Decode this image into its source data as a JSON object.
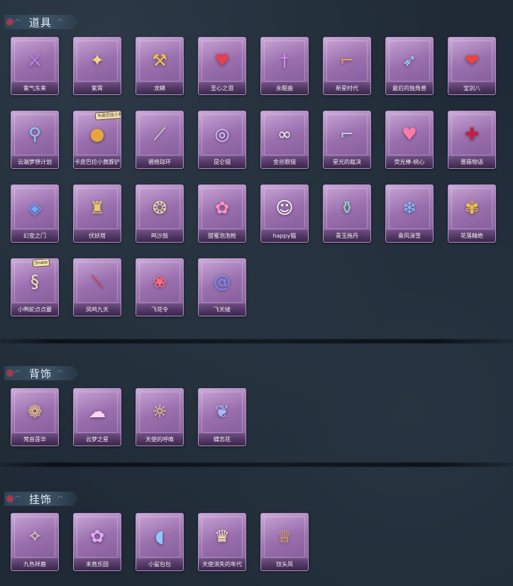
{
  "sections": {
    "props": {
      "title": "道具",
      "items": [
        {
          "name": "紫气东来",
          "icon": "purple-blade-icon",
          "glyph": "⚔",
          "color": "#c28bff"
        },
        {
          "name": "紫霄",
          "icon": "purple-chain-icon",
          "glyph": "✦",
          "color": "#f3d58a"
        },
        {
          "name": "龙鳞",
          "icon": "golden-shovel-icon",
          "glyph": "⚒",
          "color": "#e8c24a"
        },
        {
          "name": "圣心之泪",
          "icon": "red-heart-staff-icon",
          "glyph": "♥",
          "color": "#e5404f"
        },
        {
          "name": "永眠曲",
          "icon": "violet-sword-icon",
          "glyph": "†",
          "color": "#d78cff"
        },
        {
          "name": "新星时代",
          "icon": "revolver-icon",
          "glyph": "⌐",
          "color": "#e6a24a"
        },
        {
          "name": "最后的独角兽",
          "icon": "unicorn-horn-icon",
          "glyph": "➶",
          "color": "#8fd4ff"
        },
        {
          "name": "宝剑八",
          "icon": "heart-shield-icon",
          "glyph": "❤",
          "color": "#e9463d"
        },
        {
          "name": "云端梦想计划",
          "icon": "blue-hammer-icon",
          "glyph": "⚲",
          "color": "#8ecbff"
        },
        {
          "name": "卡皮巴拉小黄豚铲",
          "icon": "capybara-icon",
          "glyph": "●",
          "color": "#e8a53a",
          "badge": "卡皮巴拉小黄豚"
        },
        {
          "name": "碧络琼环",
          "icon": "jade-sword-icon",
          "glyph": "⟋",
          "color": "#cfe8d2"
        },
        {
          "name": "昆仑镜",
          "icon": "ornate-mirror-icon",
          "glyph": "◎",
          "color": "#d8c9ff"
        },
        {
          "name": "金丝眼镜",
          "icon": "glasses-icon",
          "glyph": "∞",
          "color": "#f1f1f1"
        },
        {
          "name": "星光的裁决",
          "icon": "silver-gun-icon",
          "glyph": "⌐",
          "color": "#bcd0e6"
        },
        {
          "name": "荧光棒-桃心",
          "icon": "glowstick-heart-icon",
          "glyph": "♥",
          "color": "#ff7aa8"
        },
        {
          "name": "蔷薇物语",
          "icon": "medical-kit-icon",
          "glyph": "✚",
          "color": "#c81f3b"
        },
        {
          "name": "幻变之门",
          "icon": "dimension-gate-icon",
          "glyph": "◈",
          "color": "#6fa8ff"
        },
        {
          "name": "伏妖塔",
          "icon": "pagoda-icon",
          "glyph": "♜",
          "color": "#e8c86a"
        },
        {
          "name": "鸣沙鼓",
          "icon": "dreamcatcher-icon",
          "glyph": "❂",
          "color": "#e6d3a4"
        },
        {
          "name": "甜蜜泡泡枪",
          "icon": "bubble-gun-icon",
          "glyph": "✿",
          "color": "#ff8fbf"
        },
        {
          "name": "happy猫",
          "icon": "cat-figure-icon",
          "glyph": "☺",
          "color": "#ffffff"
        },
        {
          "name": "青玉拖丹",
          "icon": "jade-vase-icon",
          "glyph": "⚱",
          "color": "#8fd0c8"
        },
        {
          "name": "乘风淌雪",
          "icon": "ice-glasses-icon",
          "glyph": "❄",
          "color": "#7fc1ff"
        },
        {
          "name": "花落精绝",
          "icon": "golden-flower-icon",
          "glyph": "✾",
          "color": "#f2c14a"
        },
        {
          "name": "小鸭蛇点点蘑",
          "icon": "snake-mushroom-icon",
          "glyph": "§",
          "color": "#f4e6c0",
          "badge": "Snake"
        },
        {
          "name": "凤鸣九天",
          "icon": "phoenix-blade-icon",
          "glyph": "⟍",
          "color": "#e3303b"
        },
        {
          "name": "飞花令",
          "icon": "flower-bouquet-icon",
          "glyph": "❀",
          "color": "#ff6a7a"
        },
        {
          "name": "飞天绫",
          "icon": "ribbon-swirl-icon",
          "glyph": "@",
          "color": "#6f8dff"
        }
      ]
    },
    "back": {
      "title": "背饰",
      "items": [
        {
          "name": "梵音莲华",
          "icon": "lotus-doll-icon",
          "glyph": "❁",
          "color": "#f3c98a"
        },
        {
          "name": "云梦之星",
          "icon": "unicorn-cloud-icon",
          "glyph": "☁",
          "color": "#ffd6f2"
        },
        {
          "name": "天使的呼唤",
          "icon": "angel-doll-icon",
          "glyph": "☼",
          "color": "#ffe27a"
        },
        {
          "name": "蝶恋花",
          "icon": "butterfly-ornament-icon",
          "glyph": "❦",
          "color": "#a6b8ff"
        }
      ]
    },
    "pendant": {
      "title": "挂饰",
      "items": [
        {
          "name": "九色祥鹿",
          "icon": "deer-charm-icon",
          "glyph": "✧",
          "color": "#f0e1c8"
        },
        {
          "name": "未竟乐园",
          "icon": "bunny-doll-icon",
          "glyph": "✿",
          "color": "#e8a8ff"
        },
        {
          "name": "小鲨包包",
          "icon": "shark-plush-icon",
          "glyph": "◖",
          "color": "#8ccaff"
        },
        {
          "name": "天使消失的年代",
          "icon": "angel-portrait-icon",
          "glyph": "♛",
          "color": "#f5e3b8"
        },
        {
          "name": "钗头凤",
          "icon": "phoenix-crown-doll-icon",
          "glyph": "♕",
          "color": "#f2b84a"
        }
      ]
    }
  }
}
